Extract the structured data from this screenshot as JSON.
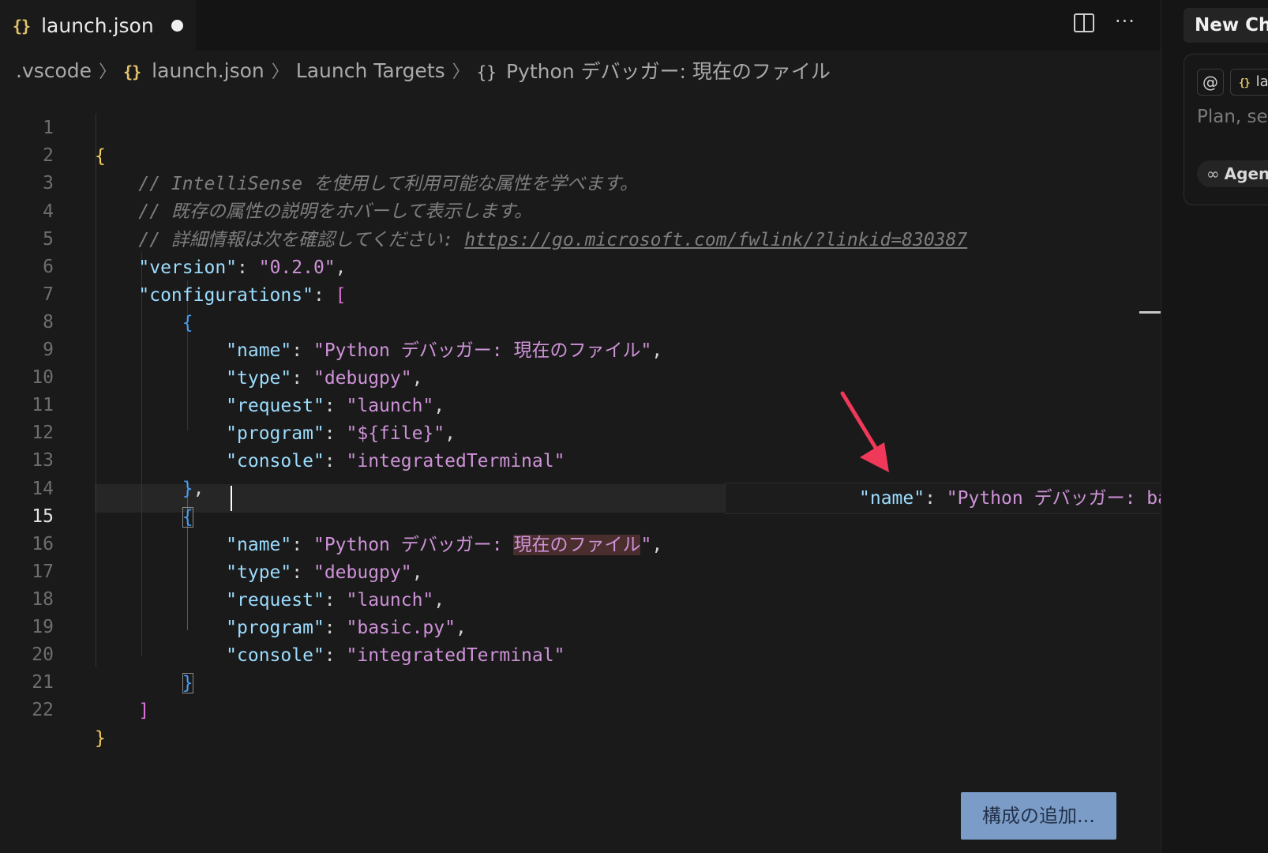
{
  "tab": {
    "icon": "{}",
    "title": "launch.json",
    "dirty": true
  },
  "toolbar": {
    "split_icon": "split-editor-icon",
    "more_label": "···"
  },
  "breadcrumb": {
    "items": [
      ".vscode",
      "launch.json",
      "Launch Targets",
      "Python デバッガー: 現在のファイル"
    ],
    "json_icon": "{}",
    "object_icon": "{}"
  },
  "editor": {
    "active_line": 15,
    "line_numbers": [
      "1",
      "2",
      "3",
      "4",
      "5",
      "6",
      "7",
      "8",
      "9",
      "10",
      "11",
      "12",
      "13",
      "14",
      "15",
      "16",
      "17",
      "18",
      "19",
      "20",
      "21",
      "22"
    ],
    "comments": [
      "// IntelliSense を使用して利用可能な属性を学べます。",
      "// 既存の属性の説明をホバーして表示します。",
      "// 詳細情報は次を確認してください: "
    ],
    "comment_link": "https://go.microsoft.com/fwlink/?linkid=830387",
    "keys": {
      "version": "\"version\"",
      "configurations": "\"configurations\"",
      "name": "\"name\"",
      "type": "\"type\"",
      "request": "\"request\"",
      "program": "\"program\"",
      "console": "\"console\""
    },
    "values": {
      "version": "\"0.2.0\"",
      "config1_name": "\"Python デバッガー: 現在のファイル\"",
      "config1_type": "\"debugpy\"",
      "config1_request": "\"launch\"",
      "config1_program": "\"${file}\"",
      "config1_console": "\"integratedTerminal\"",
      "config2_name_prefix": "\"Python デバッガー: ",
      "config2_name_highlight": "現在のファイル",
      "config2_name_suffix": "\"",
      "config2_type": "\"debugpy\"",
      "config2_request": "\"launch\"",
      "config2_program": "\"basic.py\"",
      "config2_console": "\"integratedTerminal\""
    },
    "suggestion": {
      "key": "\"name\"",
      "value": "\"Python デバッガー: basic.p"
    }
  },
  "add_config_button": "構成の追加...",
  "chat": {
    "tab_title": "New Chat",
    "mention_label": "@",
    "context_icon": "{}",
    "context_label": "launch.json",
    "input_placeholder": "Plan, search, build anything",
    "mode_icon": "∞",
    "mode_label": "Agent"
  },
  "colors": {
    "background": "#1a1a1a",
    "json_key": "#9cdcfe",
    "json_string": "#ce92d8",
    "bracket_level1": "#f4cf5b",
    "bracket_level2": "#da70d6",
    "bracket_level3": "#4a9df1",
    "comment": "#7e7e7e",
    "annotation_arrow": "#f0385a",
    "button_bg": "#7b9cc7"
  }
}
